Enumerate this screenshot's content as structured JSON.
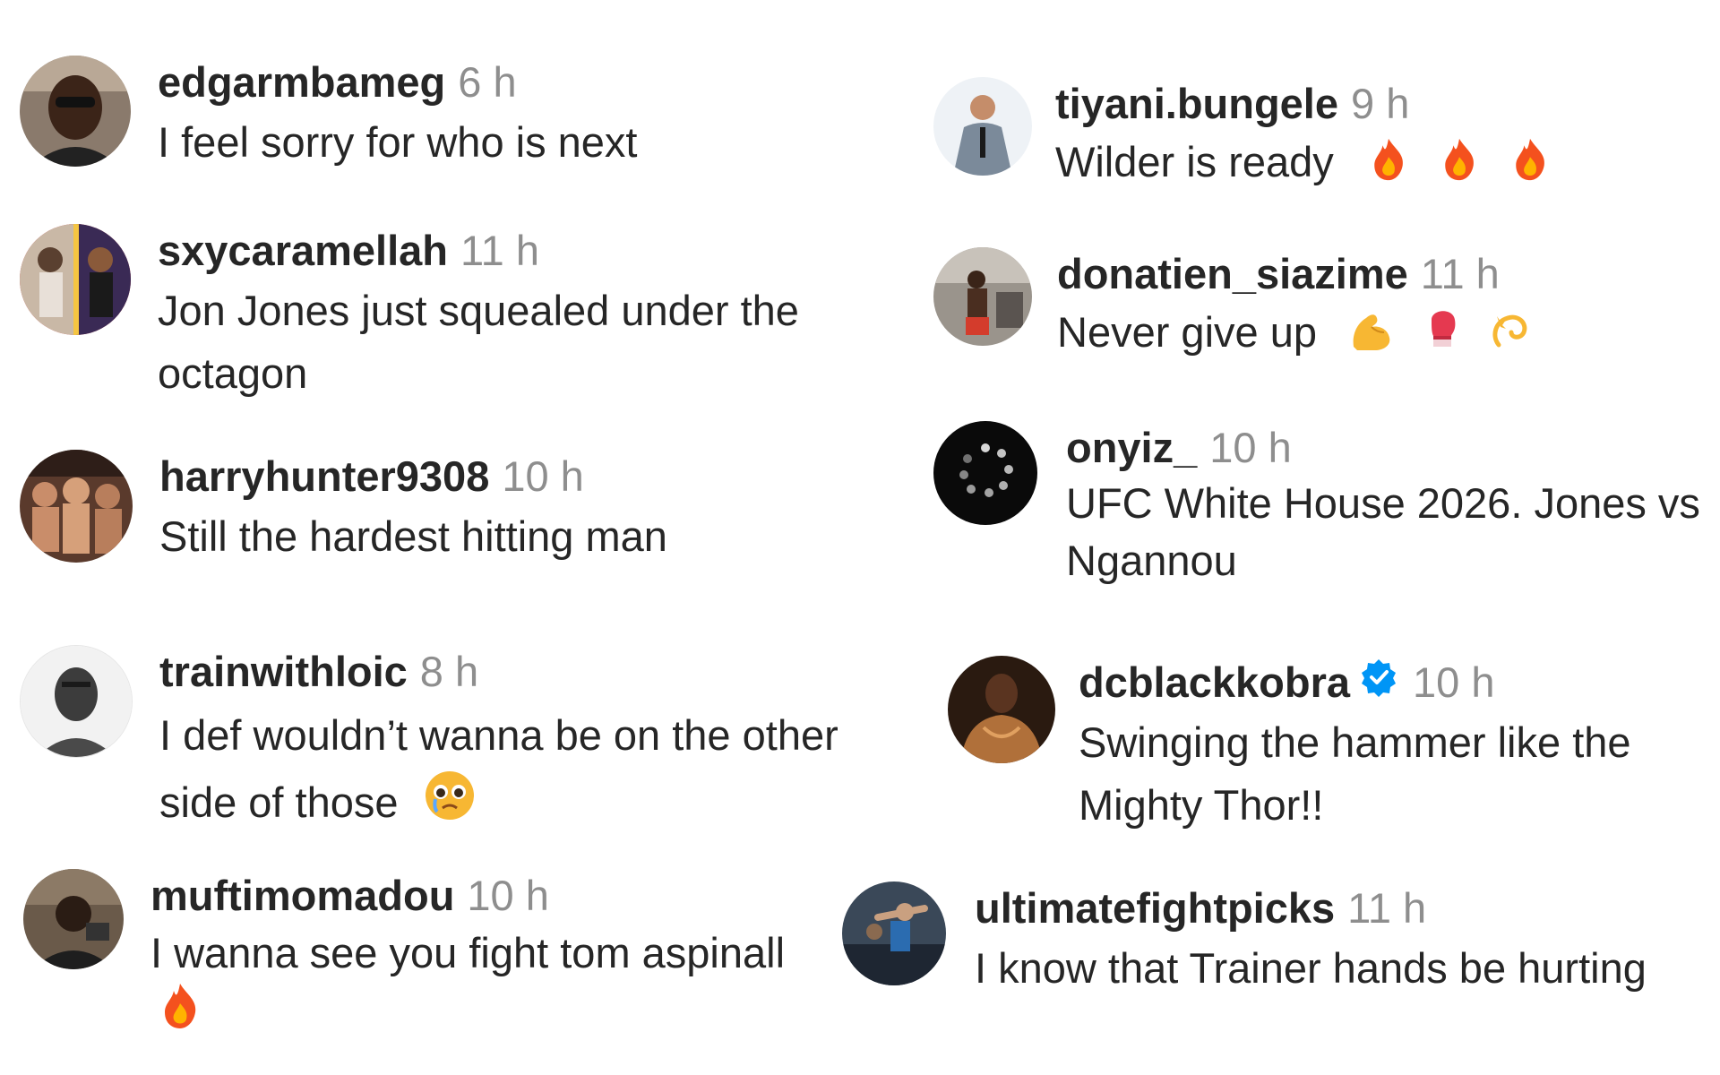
{
  "comments": [
    {
      "username": "edgarmbameg",
      "time": "6 h",
      "text": "I feel sorry for who is next",
      "verified": false
    },
    {
      "username": "sxycaramellah",
      "time": "11 h",
      "text": "Jon Jones just squealed under the octagon",
      "verified": false
    },
    {
      "username": "harryhunter9308",
      "time": "10 h",
      "text": "Still the hardest hitting man",
      "verified": false
    },
    {
      "username": "trainwithloic",
      "time": "8 h",
      "text": "I def wouldn’t wanna be on the other side of those",
      "verified": false,
      "emoji": "pleading-face"
    },
    {
      "username": "muftimomadou",
      "time": "10 h",
      "text": "I wanna see you fight tom aspinall",
      "verified": false,
      "emoji": "fire"
    },
    {
      "username": "tiyani.bungele",
      "time": "9 h",
      "text": "Wilder is ready",
      "verified": false,
      "emoji": [
        "fire",
        "fire",
        "fire"
      ]
    },
    {
      "username": "donatien_siazime",
      "time": "11 h",
      "text": "Never give up",
      "verified": false,
      "emoji": [
        "flexed-biceps",
        "boxing-glove",
        "dizzy"
      ]
    },
    {
      "username": "onyiz_",
      "time": "10 h",
      "text": "UFC White House 2026. Jones vs Ngannou",
      "verified": false
    },
    {
      "username": "dcblackkobra",
      "time": "10 h",
      "text": "Swinging the hammer like the Mighty Thor!!",
      "verified": true
    },
    {
      "username": "ultimatefightpicks",
      "time": "11 h",
      "text": "I know that Trainer hands be hurting",
      "verified": false
    }
  ],
  "colors": {
    "username": "#262626",
    "time": "#8e8e8e",
    "text": "#262626",
    "verified": "#0095f6"
  },
  "icons": {
    "verified": "verified-badge-icon",
    "fire": "fire-emoji-icon",
    "pleading": "pleading-face-emoji-icon",
    "biceps": "flexed-biceps-emoji-icon",
    "glove": "boxing-glove-emoji-icon",
    "dizzy": "dizzy-emoji-icon"
  }
}
